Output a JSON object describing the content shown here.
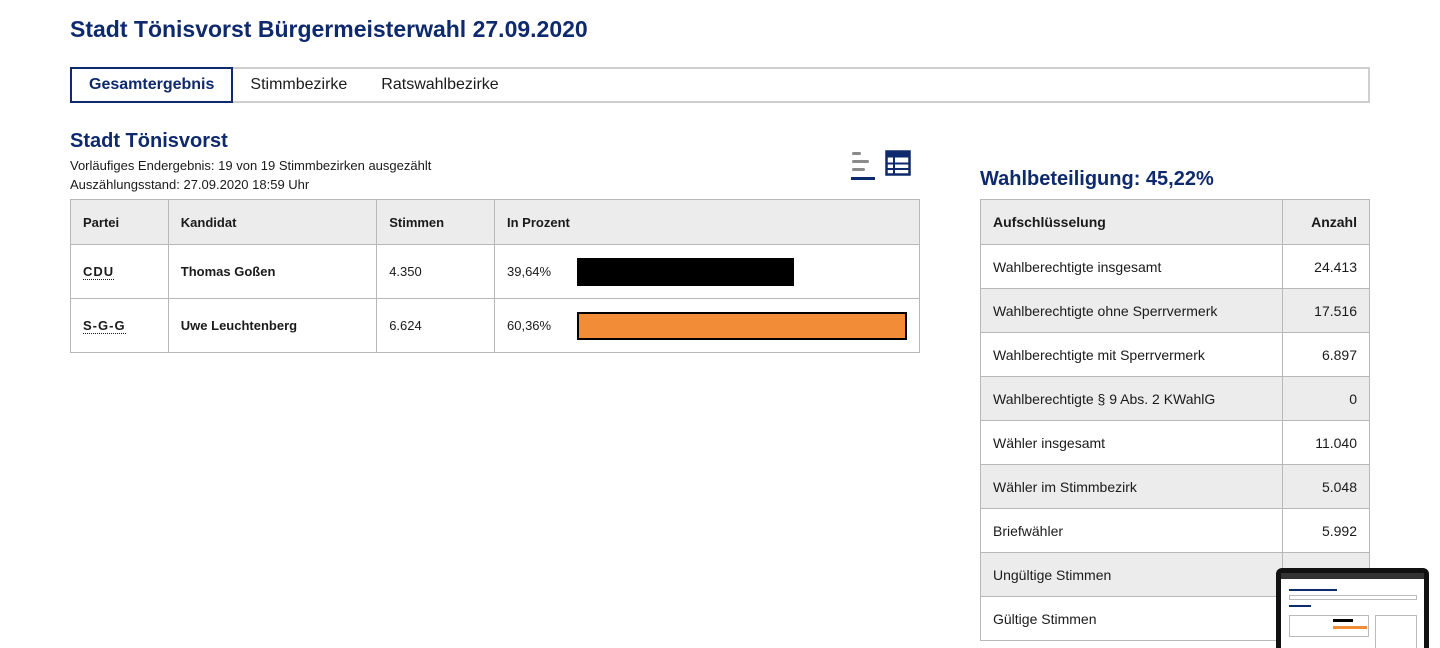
{
  "page": {
    "title": "Stadt Tönisvorst Bürgermeisterwahl 27.09.2020"
  },
  "tabs": [
    {
      "label": "Gesamtergebnis",
      "active": true
    },
    {
      "label": "Stimmbezirke",
      "active": false
    },
    {
      "label": "Ratswahlbezirke",
      "active": false
    }
  ],
  "result": {
    "title": "Stadt Tönisvorst",
    "status_line": "Vorläufiges Endergebnis: 19 von 19 Stimmbezirken ausgezählt",
    "timestamp_line": "Auszählungsstand: 27.09.2020 18:59 Uhr",
    "view_icons": [
      "bar-chart-view-icon",
      "table-view-icon"
    ],
    "headers": {
      "party": "Partei",
      "candidate": "Kandidat",
      "votes": "Stimmen",
      "percent": "In Prozent"
    },
    "rows": [
      {
        "party": "CDU",
        "candidate": "Thomas Goßen",
        "votes": "4.350",
        "percent": "39,64%",
        "share": 0.3964,
        "color": "#000000"
      },
      {
        "party": "S-G-G",
        "candidate": "Uwe Leuchtenberg",
        "votes": "6.624",
        "percent": "60,36%",
        "share": 0.6036,
        "color": "#f28c36"
      }
    ]
  },
  "turnout": {
    "title": "Wahlbeteiligung: 45,22%",
    "headers": {
      "label": "Aufschlüsselung",
      "value": "Anzahl"
    },
    "rows": [
      {
        "label": "Wahlberechtigte insgesamt",
        "value": "24.413"
      },
      {
        "label": "Wahlberechtigte ohne Sperrvermerk",
        "value": "17.516"
      },
      {
        "label": "Wahlberechtigte mit Sperrvermerk",
        "value": "6.897"
      },
      {
        "label": "Wahlberechtigte § 9 Abs. 2 KWahlG",
        "value": "0"
      },
      {
        "label": "Wähler insgesamt",
        "value": "11.040"
      },
      {
        "label": "Wähler im Stimmbezirk",
        "value": "5.048"
      },
      {
        "label": "Briefwähler",
        "value": "5.992"
      },
      {
        "label": "Ungültige Stimmen",
        "value": ""
      },
      {
        "label": "Gültige Stimmen",
        "value": ""
      }
    ]
  },
  "colors": {
    "accent": "#0e2a6c",
    "header_bg": "#ececec",
    "border": "#b8b8b8"
  }
}
